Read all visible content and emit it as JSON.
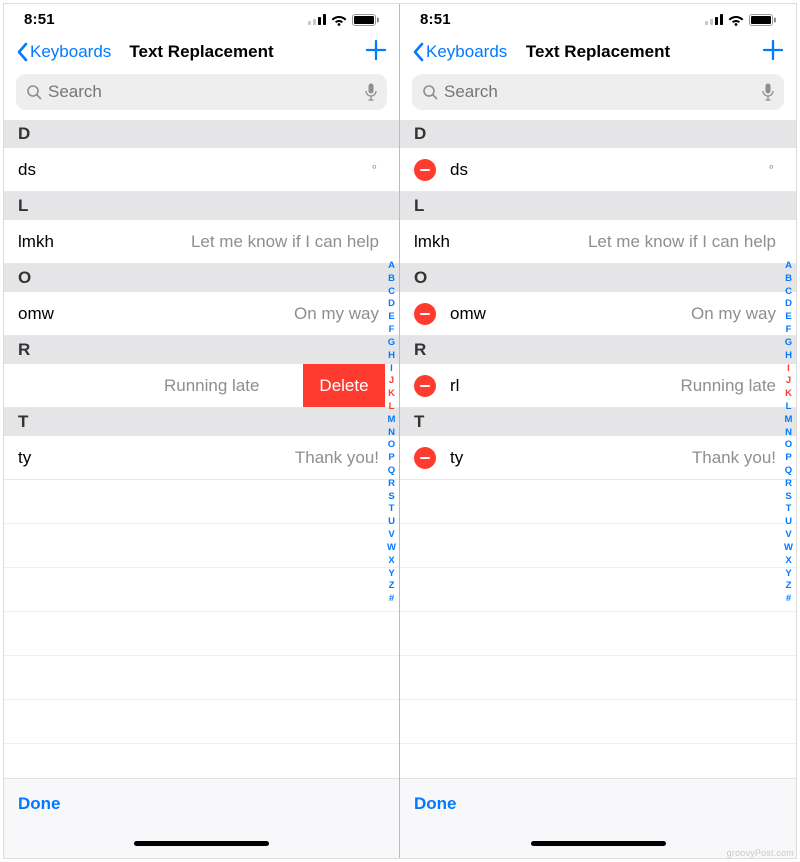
{
  "status": {
    "time": "8:51"
  },
  "nav": {
    "back_label": "Keyboards",
    "title": "Text Replacement"
  },
  "search": {
    "placeholder": "Search"
  },
  "index_letters": [
    "A",
    "B",
    "C",
    "D",
    "E",
    "F",
    "G",
    "H",
    "I",
    "J",
    "K",
    "L",
    "M",
    "N",
    "O",
    "P",
    "Q",
    "R",
    "S",
    "T",
    "U",
    "V",
    "W",
    "X",
    "Y",
    "Z",
    "#"
  ],
  "left": {
    "sections": {
      "D": {
        "header": "D",
        "shortcut": "ds",
        "phrase": "",
        "extra": "°"
      },
      "L": {
        "header": "L",
        "shortcut": "lmkh",
        "phrase": "Let me know if I can help"
      },
      "O": {
        "header": "O",
        "shortcut": "omw",
        "phrase": "On my way"
      },
      "R": {
        "header": "R",
        "shortcut": "",
        "phrase": "Running late",
        "delete_label": "Delete"
      },
      "T": {
        "header": "T",
        "shortcut": "ty",
        "phrase": "Thank you!"
      }
    }
  },
  "right": {
    "sections": {
      "D": {
        "header": "D",
        "shortcut": "ds",
        "phrase": "",
        "extra": "°"
      },
      "L": {
        "header": "L",
        "shortcut": "lmkh",
        "phrase": "Let me know if I can help"
      },
      "O": {
        "header": "O",
        "shortcut": "omw",
        "phrase": "On my way"
      },
      "R": {
        "header": "R",
        "shortcut": "rl",
        "phrase": "Running late"
      },
      "T": {
        "header": "T",
        "shortcut": "ty",
        "phrase": "Thank you!"
      }
    }
  },
  "toolbar": {
    "done_label": "Done"
  },
  "watermark": "groovyPost.com"
}
